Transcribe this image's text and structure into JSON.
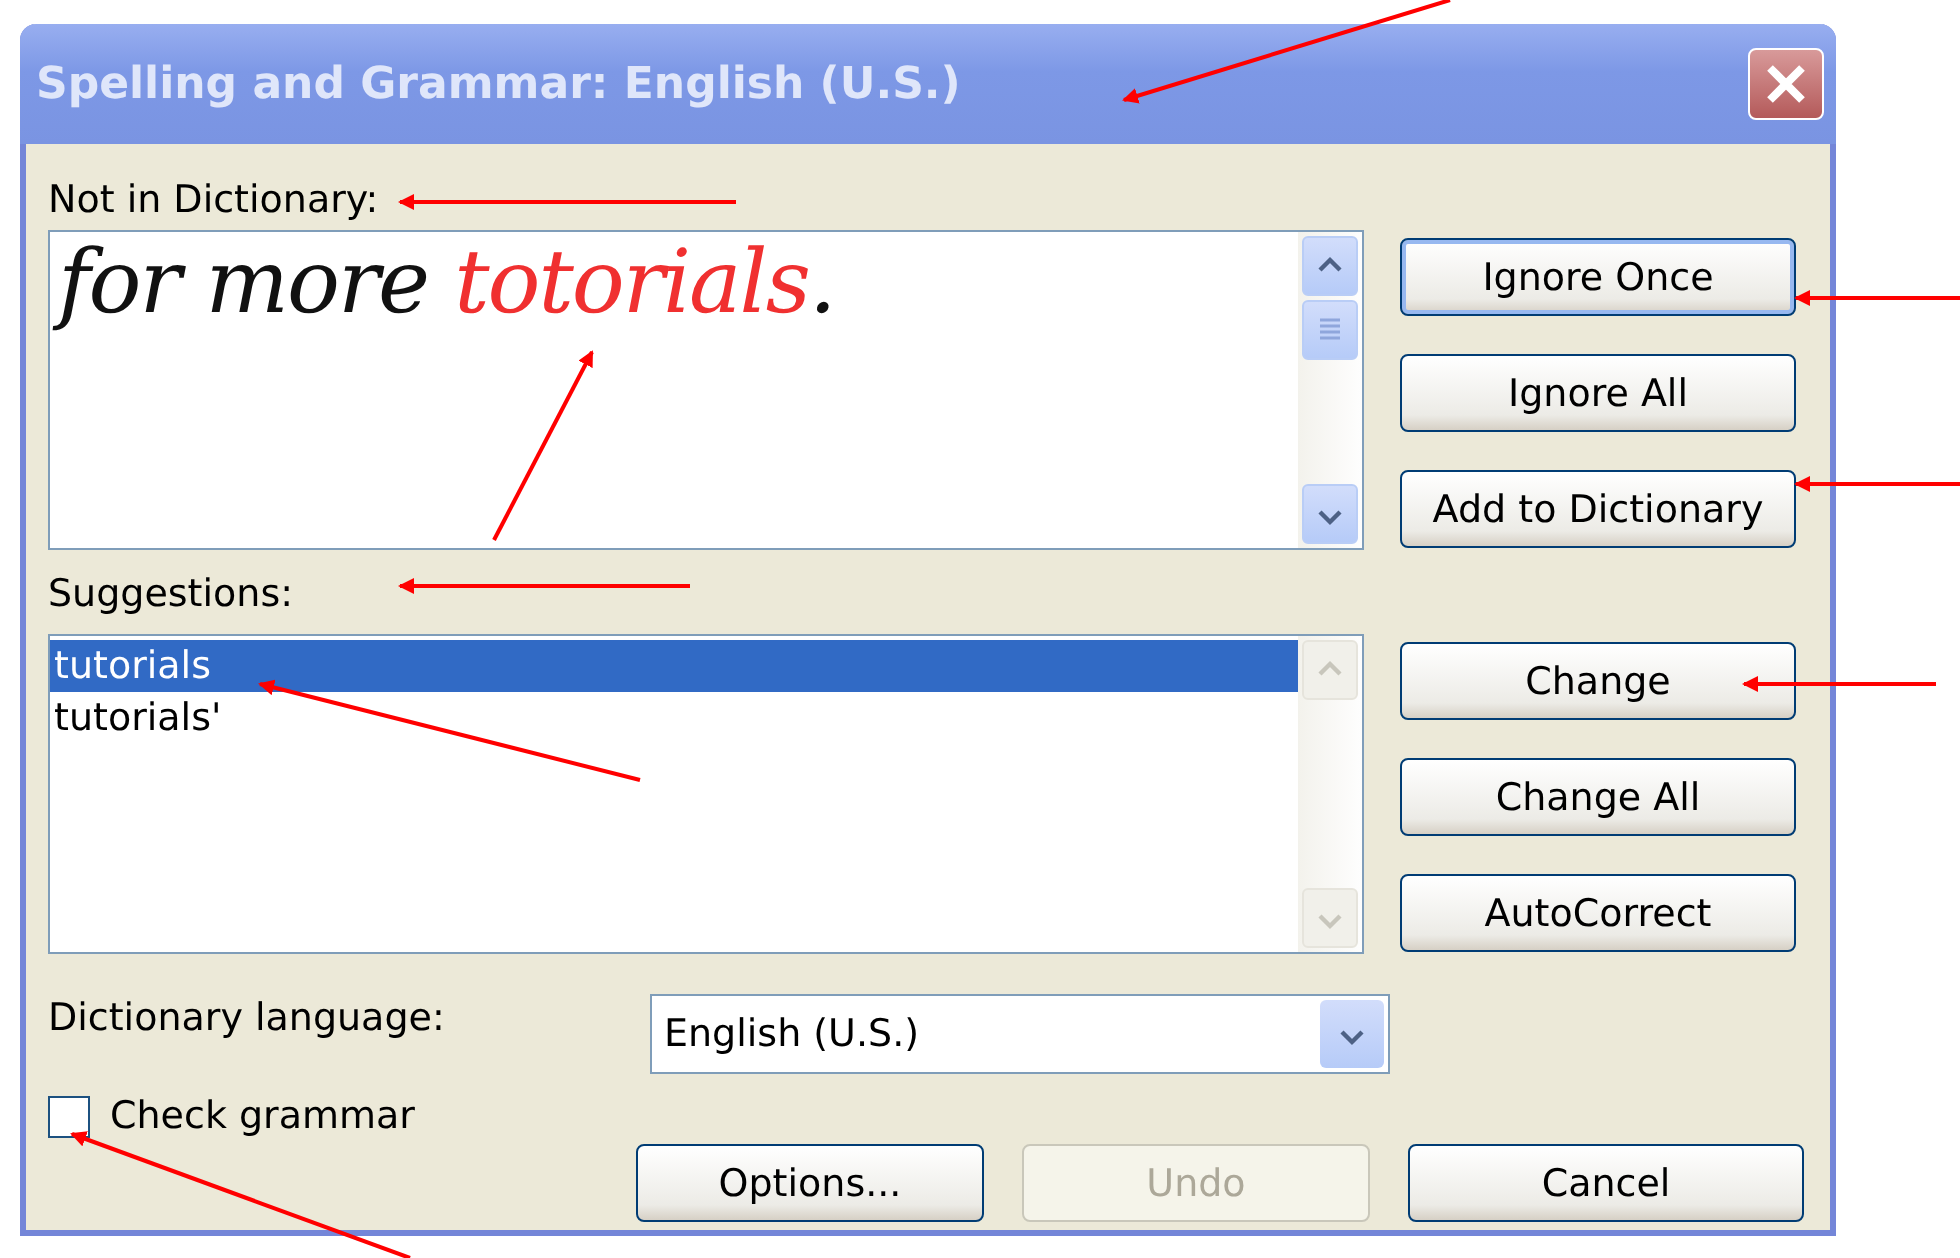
{
  "window": {
    "title": "Spelling and Grammar: English (U.S.)"
  },
  "not_in_dictionary": {
    "label": "Not in Dictionary:",
    "segments": [
      {
        "text": "for more ",
        "error": false
      },
      {
        "text": "totorials",
        "error": true
      },
      {
        "text": ".",
        "error": false
      }
    ]
  },
  "suggestions": {
    "label": "Suggestions:",
    "items": [
      {
        "text": "tutorials",
        "selected": true
      },
      {
        "text": "tutorials'",
        "selected": false
      }
    ]
  },
  "ignore_buttons": [
    {
      "label": "Ignore Once",
      "focused": true
    },
    {
      "label": "Ignore All",
      "focused": false
    },
    {
      "label": "Add to Dictionary",
      "focused": false
    }
  ],
  "change_buttons": [
    {
      "label": "Change",
      "focused": false
    },
    {
      "label": "Change All",
      "focused": false
    },
    {
      "label": "AutoCorrect",
      "focused": false
    }
  ],
  "dictionary_language": {
    "label": "Dictionary language:",
    "value": "English (U.S.)"
  },
  "check_grammar": {
    "label": "Check grammar",
    "checked": false
  },
  "bottom_buttons": [
    {
      "label": "Options...",
      "disabled": false
    },
    {
      "label": "Undo",
      "disabled": true
    },
    {
      "label": "Cancel",
      "disabled": false
    }
  ]
}
